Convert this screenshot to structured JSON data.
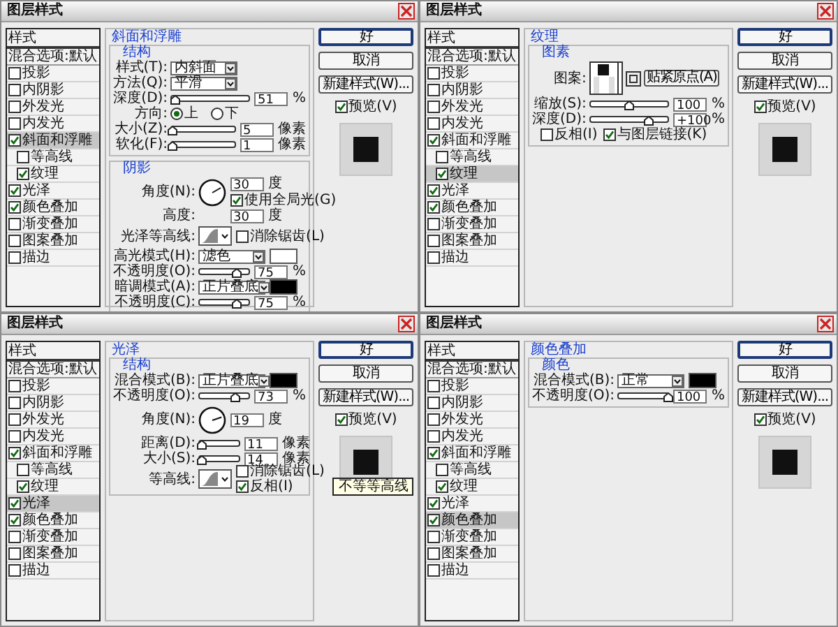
{
  "dialogs": [
    {
      "title": "图层样式",
      "styles": [
        {
          "label": "样式",
          "kind": "header",
          "selected": false
        },
        {
          "label": "混合选项:默认",
          "kind": "blend",
          "selected": false
        },
        {
          "label": "投影",
          "kind": "effect",
          "checked": false,
          "selected": false
        },
        {
          "label": "内阴影",
          "kind": "effect",
          "checked": false,
          "selected": false
        },
        {
          "label": "外发光",
          "kind": "effect",
          "checked": false,
          "selected": false
        },
        {
          "label": "内发光",
          "kind": "effect",
          "checked": false,
          "selected": false
        },
        {
          "label": "斜面和浮雕",
          "kind": "effect",
          "checked": true,
          "selected": true
        },
        {
          "label": "等高线",
          "kind": "sub",
          "checked": false,
          "selected": false
        },
        {
          "label": "纹理",
          "kind": "sub",
          "checked": true,
          "selected": false
        },
        {
          "label": "光泽",
          "kind": "effect",
          "checked": true,
          "selected": false
        },
        {
          "label": "颜色叠加",
          "kind": "effect",
          "checked": true,
          "selected": false
        },
        {
          "label": "渐变叠加",
          "kind": "effect",
          "checked": false,
          "selected": false
        },
        {
          "label": "图案叠加",
          "kind": "effect",
          "checked": false,
          "selected": false
        },
        {
          "label": "描边",
          "kind": "effect",
          "checked": false,
          "selected": false
        }
      ],
      "panel": {
        "title": "斜面和浮雕",
        "groups": [
          {
            "title": "结构",
            "rows": [
              {
                "kind": "select",
                "label": "样式(T):",
                "value": "内斜面"
              },
              {
                "kind": "select",
                "label": "方法(Q):",
                "value": "平滑"
              },
              {
                "kind": "slider",
                "label": "深度(D):",
                "level": 0.05,
                "value": "51",
                "unit": "%"
              },
              {
                "kind": "radio",
                "label": "方向:",
                "options": [
                  {
                    "label": "上",
                    "selected": true
                  },
                  {
                    "label": "下",
                    "selected": false
                  }
                ]
              },
              {
                "kind": "slider",
                "label": "大小(Z):",
                "level": 0.02,
                "value": "5",
                "unit": "像素"
              },
              {
                "kind": "slider",
                "label": "软化(F):",
                "level": 0.02,
                "value": "1",
                "unit": "像素"
              }
            ]
          },
          {
            "title": "阴影",
            "rows": [
              {
                "kind": "angle",
                "label": "角度(N):",
                "value": "30",
                "unit": "度",
                "check": {
                  "label": "使用全局光(G)",
                  "checked": true
                }
              },
              {
                "kind": "number",
                "label": "高度:",
                "value": "30",
                "unit": "度"
              },
              {
                "kind": "contour",
                "label": "光泽等高线:",
                "checks": [
                  {
                    "label": "消除锯齿(L)",
                    "checked": false
                  }
                ]
              },
              {
                "kind": "select",
                "label": "高光模式(H):",
                "value": "滤色",
                "color": "#ffffff"
              },
              {
                "kind": "slider",
                "label": "不透明度(O):",
                "level": 0.75,
                "value": "75",
                "unit": "%"
              },
              {
                "kind": "select",
                "label": "暗调模式(A):",
                "value": "正片叠底",
                "color": "#000000"
              },
              {
                "kind": "slider",
                "label": "不透明度(C):",
                "level": 0.75,
                "value": "75",
                "unit": "%"
              }
            ]
          }
        ]
      },
      "buttons": [
        {
          "label": "好",
          "default": true
        },
        {
          "label": "取消",
          "default": false
        },
        {
          "label": "新建样式(W)...",
          "default": false
        }
      ],
      "preview": {
        "label": "预览(V)",
        "checked": true
      }
    },
    {
      "title": "图层样式",
      "styles": [
        {
          "label": "样式",
          "kind": "header",
          "selected": false
        },
        {
          "label": "混合选项:默认",
          "kind": "blend",
          "selected": false
        },
        {
          "label": "投影",
          "kind": "effect",
          "checked": false,
          "selected": false
        },
        {
          "label": "内阴影",
          "kind": "effect",
          "checked": false,
          "selected": false
        },
        {
          "label": "外发光",
          "kind": "effect",
          "checked": false,
          "selected": false
        },
        {
          "label": "内发光",
          "kind": "effect",
          "checked": false,
          "selected": false
        },
        {
          "label": "斜面和浮雕",
          "kind": "effect",
          "checked": true,
          "selected": false
        },
        {
          "label": "等高线",
          "kind": "sub",
          "checked": false,
          "selected": false
        },
        {
          "label": "纹理",
          "kind": "sub",
          "checked": true,
          "selected": true
        },
        {
          "label": "光泽",
          "kind": "effect",
          "checked": true,
          "selected": false
        },
        {
          "label": "颜色叠加",
          "kind": "effect",
          "checked": true,
          "selected": false
        },
        {
          "label": "渐变叠加",
          "kind": "effect",
          "checked": false,
          "selected": false
        },
        {
          "label": "图案叠加",
          "kind": "effect",
          "checked": false,
          "selected": false
        },
        {
          "label": "描边",
          "kind": "effect",
          "checked": false,
          "selected": false
        }
      ],
      "panel": {
        "title": "纹理",
        "groups": [
          {
            "title": "图素",
            "rows": [
              {
                "kind": "pattern",
                "label": "图案:",
                "button": "贴紧原点(A)"
              },
              {
                "kind": "slider",
                "label": "缩放(S):",
                "level": 0.5,
                "value": "100",
                "unit": "%"
              },
              {
                "kind": "slider",
                "label": "深度(D):",
                "level": 0.75,
                "value": "+100",
                "unit": "%"
              },
              {
                "kind": "checks",
                "checks": [
                  {
                    "label": "反相(I)",
                    "checked": false
                  },
                  {
                    "label": "与图层链接(K)",
                    "checked": true
                  }
                ]
              }
            ]
          }
        ]
      },
      "buttons": [
        {
          "label": "好",
          "default": true
        },
        {
          "label": "取消",
          "default": false
        },
        {
          "label": "新建样式(W)...",
          "default": false
        }
      ],
      "preview": {
        "label": "预览(V)",
        "checked": true
      }
    },
    {
      "title": "图层样式",
      "styles": [
        {
          "label": "样式",
          "kind": "header",
          "selected": false
        },
        {
          "label": "混合选项:默认",
          "kind": "blend",
          "selected": false
        },
        {
          "label": "投影",
          "kind": "effect",
          "checked": false,
          "selected": false
        },
        {
          "label": "内阴影",
          "kind": "effect",
          "checked": false,
          "selected": false
        },
        {
          "label": "外发光",
          "kind": "effect",
          "checked": false,
          "selected": false
        },
        {
          "label": "内发光",
          "kind": "effect",
          "checked": false,
          "selected": false
        },
        {
          "label": "斜面和浮雕",
          "kind": "effect",
          "checked": true,
          "selected": false
        },
        {
          "label": "等高线",
          "kind": "sub",
          "checked": false,
          "selected": false
        },
        {
          "label": "纹理",
          "kind": "sub",
          "checked": true,
          "selected": false
        },
        {
          "label": "光泽",
          "kind": "effect",
          "checked": true,
          "selected": true
        },
        {
          "label": "颜色叠加",
          "kind": "effect",
          "checked": true,
          "selected": false
        },
        {
          "label": "渐变叠加",
          "kind": "effect",
          "checked": false,
          "selected": false
        },
        {
          "label": "图案叠加",
          "kind": "effect",
          "checked": false,
          "selected": false
        },
        {
          "label": "描边",
          "kind": "effect",
          "checked": false,
          "selected": false
        }
      ],
      "panel": {
        "title": "光泽",
        "groups": [
          {
            "title": "结构",
            "rows": [
              {
                "kind": "select",
                "label": "混合模式(B):",
                "value": "正片叠底",
                "color": "#000000"
              },
              {
                "kind": "slider",
                "label": "不透明度(O):",
                "level": 0.73,
                "value": "73",
                "unit": "%"
              },
              {
                "kind": "angle",
                "label": "角度(N):",
                "value": "19",
                "unit": "度"
              },
              {
                "kind": "slider",
                "label": "距离(D):",
                "level": 0.05,
                "value": "11",
                "unit": "像素"
              },
              {
                "kind": "slider",
                "label": "大小(S):",
                "level": 0.05,
                "value": "14",
                "unit": "像素"
              },
              {
                "kind": "contour",
                "label": "等高线:",
                "checks": [
                  {
                    "label": "消除锯齿(L)",
                    "checked": false
                  },
                  {
                    "label": "反相(I)",
                    "checked": true
                  }
                ]
              }
            ]
          }
        ]
      },
      "tooltip": "不等等高线",
      "buttons": [
        {
          "label": "好",
          "default": true
        },
        {
          "label": "取消",
          "default": false
        },
        {
          "label": "新建样式(W)...",
          "default": false
        }
      ],
      "preview": {
        "label": "预览(V)",
        "checked": true
      }
    },
    {
      "title": "图层样式",
      "styles": [
        {
          "label": "样式",
          "kind": "header",
          "selected": false
        },
        {
          "label": "混合选项:默认",
          "kind": "blend",
          "selected": false
        },
        {
          "label": "投影",
          "kind": "effect",
          "checked": false,
          "selected": false
        },
        {
          "label": "内阴影",
          "kind": "effect",
          "checked": false,
          "selected": false
        },
        {
          "label": "外发光",
          "kind": "effect",
          "checked": false,
          "selected": false
        },
        {
          "label": "内发光",
          "kind": "effect",
          "checked": false,
          "selected": false
        },
        {
          "label": "斜面和浮雕",
          "kind": "effect",
          "checked": true,
          "selected": false
        },
        {
          "label": "等高线",
          "kind": "sub",
          "checked": false,
          "selected": false
        },
        {
          "label": "纹理",
          "kind": "sub",
          "checked": true,
          "selected": false
        },
        {
          "label": "光泽",
          "kind": "effect",
          "checked": true,
          "selected": false
        },
        {
          "label": "颜色叠加",
          "kind": "effect",
          "checked": true,
          "selected": true
        },
        {
          "label": "渐变叠加",
          "kind": "effect",
          "checked": false,
          "selected": false
        },
        {
          "label": "图案叠加",
          "kind": "effect",
          "checked": false,
          "selected": false
        },
        {
          "label": "描边",
          "kind": "effect",
          "checked": false,
          "selected": false
        }
      ],
      "panel": {
        "title": "颜色叠加",
        "groups": [
          {
            "title": "颜色",
            "rows": [
              {
                "kind": "select",
                "label": "混合模式(B):",
                "value": "正常",
                "color": "#000000"
              },
              {
                "kind": "slider",
                "label": "不透明度(O):",
                "level": 1,
                "value": "100",
                "unit": "%"
              }
            ]
          }
        ]
      },
      "buttons": [
        {
          "label": "好",
          "default": true
        },
        {
          "label": "取消",
          "default": false
        },
        {
          "label": "新建样式(W)...",
          "default": false
        }
      ],
      "preview": {
        "label": "预览(V)",
        "checked": true
      }
    }
  ]
}
